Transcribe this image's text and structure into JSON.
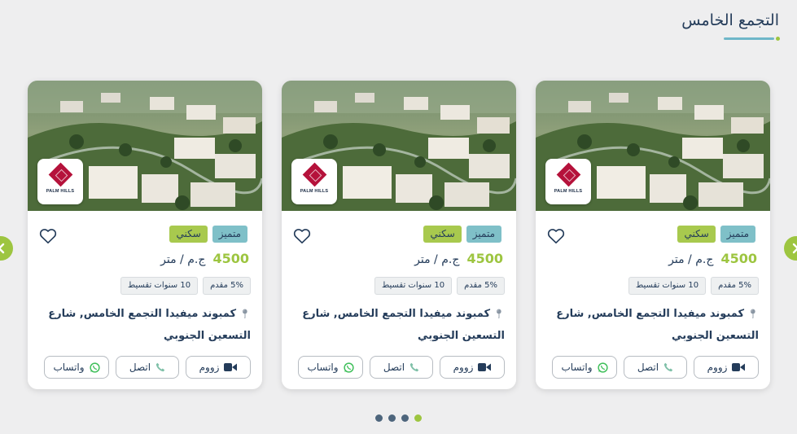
{
  "section": {
    "title": "التجمع الخامس"
  },
  "colors": {
    "accent_green": "#9dc540",
    "accent_teal": "#7fc0c8",
    "text_navy": "#243c5a"
  },
  "cards": [
    {
      "developer_logo": "palm-hills-logo",
      "logo_text": "PALM HILLS",
      "badge_featured": "متميز",
      "badge_type": "سكني",
      "price_value": "4500",
      "price_unit": "ج.م / متر",
      "tag_down_payment": "5% مقدم",
      "tag_installments": "10 سنوات تقسيط",
      "address": "كمبوند ميفيدا التجمع الخامس, شارع التسعين الجنوبي",
      "btn_zoom": "زووم",
      "btn_call": "اتصل",
      "btn_whatsapp": "واتساب"
    },
    {
      "developer_logo": "palm-hills-logo",
      "logo_text": "PALM HILLS",
      "badge_featured": "متميز",
      "badge_type": "سكني",
      "price_value": "4500",
      "price_unit": "ج.م / متر",
      "tag_down_payment": "5% مقدم",
      "tag_installments": "10 سنوات تقسيط",
      "address": "كمبوند ميفيدا التجمع الخامس, شارع التسعين الجنوبي",
      "btn_zoom": "زووم",
      "btn_call": "اتصل",
      "btn_whatsapp": "واتساب"
    },
    {
      "developer_logo": "palm-hills-logo",
      "logo_text": "PALM HILLS",
      "badge_featured": "متميز",
      "badge_type": "سكني",
      "price_value": "4500",
      "price_unit": "ج.م / متر",
      "tag_down_payment": "5% مقدم",
      "tag_installments": "10 سنوات تقسيط",
      "address": "كمبوند ميفيدا التجمع الخامس, شارع التسعين الجنوبي",
      "btn_zoom": "زووم",
      "btn_call": "اتصل",
      "btn_whatsapp": "واتساب"
    }
  ],
  "carousel": {
    "page_count": 4,
    "active_page": 4
  }
}
